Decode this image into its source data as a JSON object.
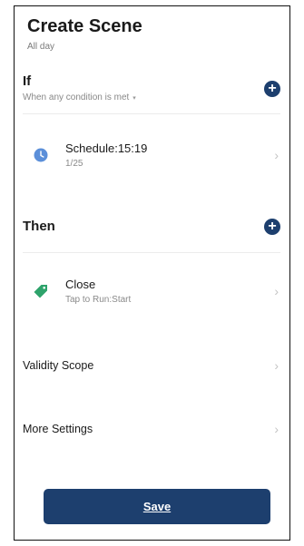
{
  "header": {
    "title": "Create Scene",
    "subtitle": "All day"
  },
  "if_section": {
    "title": "If",
    "condition_mode": "When any condition is met",
    "condition_caret": "▾",
    "add_icon": "plus-circle-icon",
    "conditions": [
      {
        "icon": "clock-icon",
        "title": "Schedule:15:19",
        "subtitle": "1/25"
      }
    ]
  },
  "then_section": {
    "title": "Then",
    "add_icon": "plus-circle-icon",
    "actions": [
      {
        "icon": "tag-icon",
        "title": "Close",
        "subtitle": "Tap to Run:Start"
      }
    ]
  },
  "settings": {
    "validity_scope": "Validity Scope",
    "more_settings": "More Settings"
  },
  "chevron": "›",
  "footer": {
    "save_label": "Save"
  },
  "colors": {
    "accent": "#1d3f6e",
    "clock": "#5b8fd9",
    "tag": "#2ea36b"
  }
}
